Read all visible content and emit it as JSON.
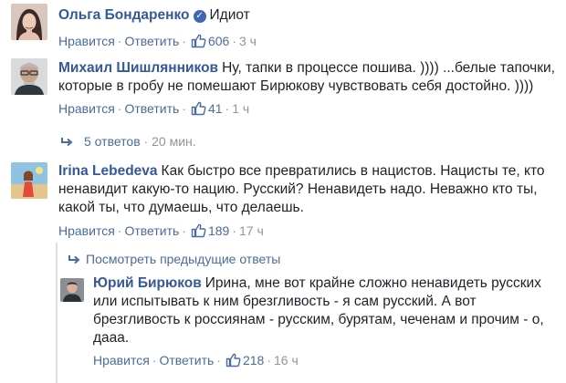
{
  "comments": [
    {
      "author": "Ольга Бондаренко",
      "verified": true,
      "text": "Идиот",
      "like_label": "Нравится",
      "reply_label": "Ответить",
      "likes": "606",
      "time": "3 ч"
    },
    {
      "author": "Михаил Шишлянников",
      "verified": false,
      "text": "Ну, тапки в процессе пошива. )))) ...белые тапочки, которые в гробу не помешают Бирюкову чувствовать себя достойно. ))))",
      "like_label": "Нравится",
      "reply_label": "Ответить",
      "likes": "41",
      "time": "1 ч"
    },
    {
      "author": "Irina Lebedeva",
      "verified": false,
      "text": "Как быстро все превратились в нацистов. Нацисты те, кто ненавидит какую-то нацию. Русский? Ненавидеть надо. Неважно кто ты, какой ты, что думаешь, что делаешь.",
      "like_label": "Нравится",
      "reply_label": "Ответить",
      "likes": "189",
      "time": "17 ч"
    },
    {
      "author": "Юрий Бирюков",
      "verified": false,
      "text": "Ирина, мне вот крайне сложно ненавидеть русских или испытывать к ним брезгливость - я сам русский. А вот брезгливость к россиянам - русским, бурятам, чеченам и прочим - о, дааа.",
      "like_label": "Нравится",
      "reply_label": "Ответить",
      "likes": "218",
      "time": "16 ч"
    }
  ],
  "replies_toggle": {
    "label": "5 ответов",
    "time": "20 мин."
  },
  "previous_replies": {
    "label": "Посмотреть предыдущие ответы"
  },
  "colors": {
    "author": "#365899",
    "link": "#4a6b9e",
    "muted": "#90949c",
    "text": "#1d2129"
  }
}
